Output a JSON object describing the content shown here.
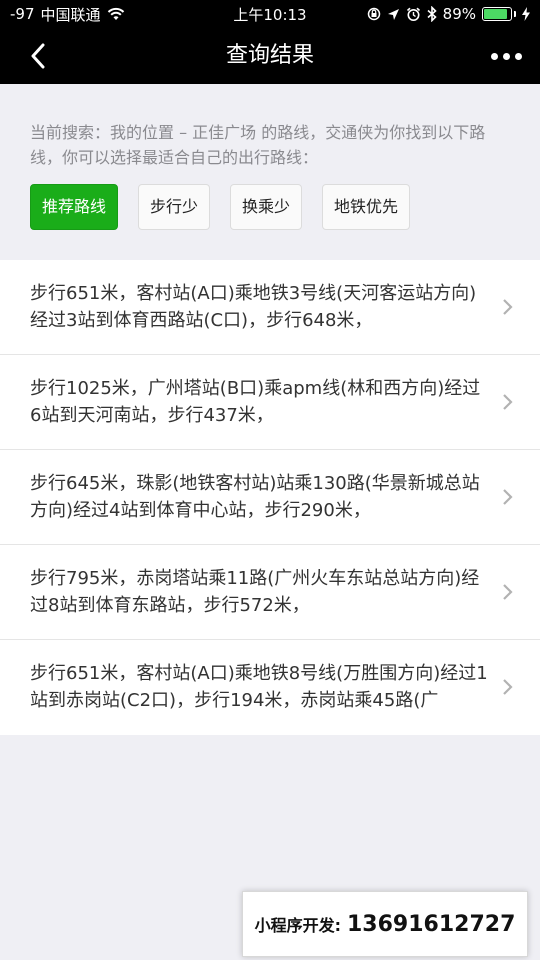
{
  "status_bar": {
    "signal": "-97",
    "carrier": "中国联通",
    "time": "上午10:13",
    "battery_text": "89%",
    "battery_level": 0.89,
    "battery_color": "#4cd964",
    "icons": [
      "wifi-icon",
      "orientation-lock-icon",
      "location-icon",
      "alarm-icon",
      "bluetooth-icon",
      "charging-icon"
    ]
  },
  "navbar": {
    "back_icon": "chevron-left-icon",
    "title": "查询结果",
    "more_icon": "more-dots-icon"
  },
  "search": {
    "description": "当前搜索：我的位置 – 正佳广场 的路线，交通侠为你找到以下路线，你可以选择最适合自己的出行路线：",
    "options": [
      {
        "label": "推荐路线",
        "active": true
      },
      {
        "label": "步行少",
        "active": false
      },
      {
        "label": "换乘少",
        "active": false
      },
      {
        "label": "地铁优先",
        "active": false
      }
    ],
    "active_color": "#1aad19"
  },
  "routes": [
    "步行651米，客村站(A口)乘地铁3号线(天河客运站方向)经过3站到体育西路站(C口)，步行648米，",
    "步行1025米，广州塔站(B口)乘apm线(林和西方向)经过6站到天河南站，步行437米，",
    "步行645米，珠影(地铁客村站)站乘130路(华景新城总站方向)经过4站到体育中心站，步行290米，",
    "步行795米，赤岗塔站乘11路(广州火车东站总站方向)经过8站到体育东路站，步行572米，",
    "步行651米，客村站(A口)乘地铁8号线(万胜围方向)经过1站到赤岗站(C2口)，步行194米，赤岗站乘45路(广"
  ],
  "promo": {
    "label": "小程序开发:",
    "phone": "13691612727"
  }
}
